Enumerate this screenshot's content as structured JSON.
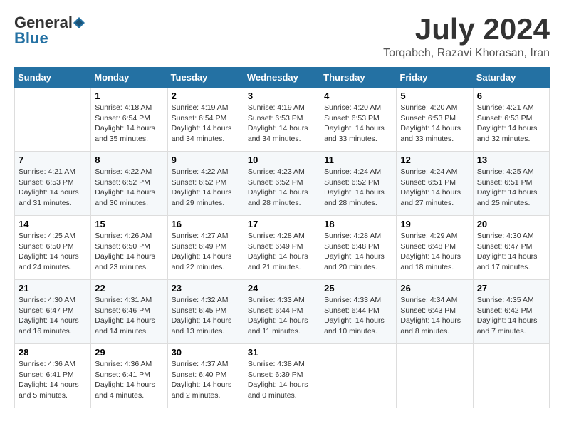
{
  "logo": {
    "general": "General",
    "blue": "Blue"
  },
  "header": {
    "month": "July 2024",
    "location": "Torqabeh, Razavi Khorasan, Iran"
  },
  "days": [
    "Sunday",
    "Monday",
    "Tuesday",
    "Wednesday",
    "Thursday",
    "Friday",
    "Saturday"
  ],
  "weeks": [
    [
      {
        "day": "",
        "content": ""
      },
      {
        "day": "1",
        "content": "Sunrise: 4:18 AM\nSunset: 6:54 PM\nDaylight: 14 hours\nand 35 minutes."
      },
      {
        "day": "2",
        "content": "Sunrise: 4:19 AM\nSunset: 6:54 PM\nDaylight: 14 hours\nand 34 minutes."
      },
      {
        "day": "3",
        "content": "Sunrise: 4:19 AM\nSunset: 6:53 PM\nDaylight: 14 hours\nand 34 minutes."
      },
      {
        "day": "4",
        "content": "Sunrise: 4:20 AM\nSunset: 6:53 PM\nDaylight: 14 hours\nand 33 minutes."
      },
      {
        "day": "5",
        "content": "Sunrise: 4:20 AM\nSunset: 6:53 PM\nDaylight: 14 hours\nand 33 minutes."
      },
      {
        "day": "6",
        "content": "Sunrise: 4:21 AM\nSunset: 6:53 PM\nDaylight: 14 hours\nand 32 minutes."
      }
    ],
    [
      {
        "day": "7",
        "content": "Sunrise: 4:21 AM\nSunset: 6:53 PM\nDaylight: 14 hours\nand 31 minutes."
      },
      {
        "day": "8",
        "content": "Sunrise: 4:22 AM\nSunset: 6:52 PM\nDaylight: 14 hours\nand 30 minutes."
      },
      {
        "day": "9",
        "content": "Sunrise: 4:22 AM\nSunset: 6:52 PM\nDaylight: 14 hours\nand 29 minutes."
      },
      {
        "day": "10",
        "content": "Sunrise: 4:23 AM\nSunset: 6:52 PM\nDaylight: 14 hours\nand 28 minutes."
      },
      {
        "day": "11",
        "content": "Sunrise: 4:24 AM\nSunset: 6:52 PM\nDaylight: 14 hours\nand 28 minutes."
      },
      {
        "day": "12",
        "content": "Sunrise: 4:24 AM\nSunset: 6:51 PM\nDaylight: 14 hours\nand 27 minutes."
      },
      {
        "day": "13",
        "content": "Sunrise: 4:25 AM\nSunset: 6:51 PM\nDaylight: 14 hours\nand 25 minutes."
      }
    ],
    [
      {
        "day": "14",
        "content": "Sunrise: 4:25 AM\nSunset: 6:50 PM\nDaylight: 14 hours\nand 24 minutes."
      },
      {
        "day": "15",
        "content": "Sunrise: 4:26 AM\nSunset: 6:50 PM\nDaylight: 14 hours\nand 23 minutes."
      },
      {
        "day": "16",
        "content": "Sunrise: 4:27 AM\nSunset: 6:49 PM\nDaylight: 14 hours\nand 22 minutes."
      },
      {
        "day": "17",
        "content": "Sunrise: 4:28 AM\nSunset: 6:49 PM\nDaylight: 14 hours\nand 21 minutes."
      },
      {
        "day": "18",
        "content": "Sunrise: 4:28 AM\nSunset: 6:48 PM\nDaylight: 14 hours\nand 20 minutes."
      },
      {
        "day": "19",
        "content": "Sunrise: 4:29 AM\nSunset: 6:48 PM\nDaylight: 14 hours\nand 18 minutes."
      },
      {
        "day": "20",
        "content": "Sunrise: 4:30 AM\nSunset: 6:47 PM\nDaylight: 14 hours\nand 17 minutes."
      }
    ],
    [
      {
        "day": "21",
        "content": "Sunrise: 4:30 AM\nSunset: 6:47 PM\nDaylight: 14 hours\nand 16 minutes."
      },
      {
        "day": "22",
        "content": "Sunrise: 4:31 AM\nSunset: 6:46 PM\nDaylight: 14 hours\nand 14 minutes."
      },
      {
        "day": "23",
        "content": "Sunrise: 4:32 AM\nSunset: 6:45 PM\nDaylight: 14 hours\nand 13 minutes."
      },
      {
        "day": "24",
        "content": "Sunrise: 4:33 AM\nSunset: 6:44 PM\nDaylight: 14 hours\nand 11 minutes."
      },
      {
        "day": "25",
        "content": "Sunrise: 4:33 AM\nSunset: 6:44 PM\nDaylight: 14 hours\nand 10 minutes."
      },
      {
        "day": "26",
        "content": "Sunrise: 4:34 AM\nSunset: 6:43 PM\nDaylight: 14 hours\nand 8 minutes."
      },
      {
        "day": "27",
        "content": "Sunrise: 4:35 AM\nSunset: 6:42 PM\nDaylight: 14 hours\nand 7 minutes."
      }
    ],
    [
      {
        "day": "28",
        "content": "Sunrise: 4:36 AM\nSunset: 6:41 PM\nDaylight: 14 hours\nand 5 minutes."
      },
      {
        "day": "29",
        "content": "Sunrise: 4:36 AM\nSunset: 6:41 PM\nDaylight: 14 hours\nand 4 minutes."
      },
      {
        "day": "30",
        "content": "Sunrise: 4:37 AM\nSunset: 6:40 PM\nDaylight: 14 hours\nand 2 minutes."
      },
      {
        "day": "31",
        "content": "Sunrise: 4:38 AM\nSunset: 6:39 PM\nDaylight: 14 hours\nand 0 minutes."
      },
      {
        "day": "",
        "content": ""
      },
      {
        "day": "",
        "content": ""
      },
      {
        "day": "",
        "content": ""
      }
    ]
  ]
}
